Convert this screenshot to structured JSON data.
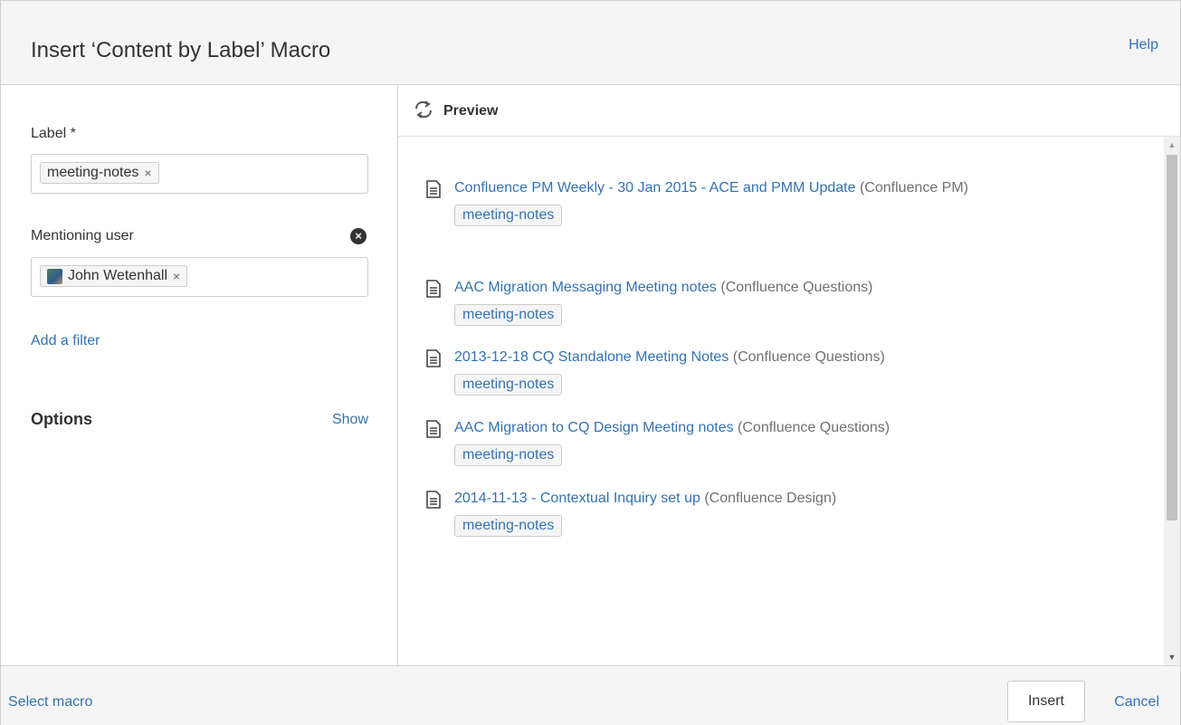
{
  "dialog": {
    "title": "Insert ‘Content by Label’ Macro",
    "help_label": "Help"
  },
  "left_panel": {
    "label_field": {
      "label": "Label *",
      "chips": [
        "meeting-notes"
      ]
    },
    "mentioning_field": {
      "label": "Mentioning user",
      "chips": [
        "John Wetenhall"
      ]
    },
    "add_filter_label": "Add a filter",
    "options": {
      "title": "Options",
      "toggle_label": "Show"
    }
  },
  "preview": {
    "title": "Preview",
    "results": [
      {
        "link": "Confluence PM Weekly - 30 Jan 2015 - ACE and PMM Update",
        "space": "(Confluence PM)",
        "label": "meeting-notes"
      },
      {
        "link": "AAC Migration Messaging Meeting notes",
        "space": "(Confluence Questions)",
        "label": "meeting-notes"
      },
      {
        "link": "2013-12-18 CQ Standalone Meeting Notes",
        "space": "(Confluence Questions)",
        "label": "meeting-notes"
      },
      {
        "link": "AAC Migration to CQ Design Meeting notes",
        "space": "(Confluence Questions)",
        "label": "meeting-notes"
      },
      {
        "link": "2014-11-13 - Contextual Inquiry set up",
        "space": "(Confluence Design)",
        "label": "meeting-notes"
      }
    ]
  },
  "footer": {
    "select_macro_label": "Select macro",
    "insert_label": "Insert",
    "cancel_label": "Cancel"
  },
  "icons": {
    "refresh": "refresh-icon",
    "document": "document-icon",
    "remove": "close-icon",
    "clear": "clear-icon",
    "avatar": "user-avatar"
  },
  "colors": {
    "link": "#3572b0",
    "header_bg": "#f5f5f5",
    "chip_bg": "#f5f5f5"
  }
}
